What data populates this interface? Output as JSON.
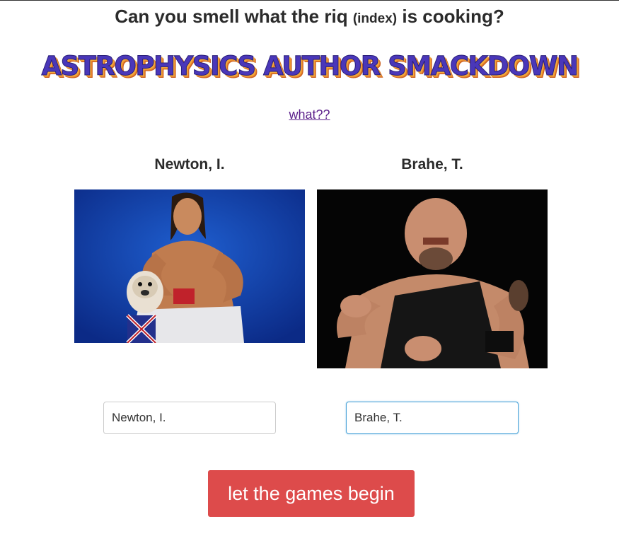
{
  "header": {
    "tagline_main": "Can you smell what the riq",
    "tagline_small": "(index)",
    "tagline_end": "is cooking?",
    "title": "ASTROPHYSICS AUTHOR SMACKDOWN",
    "what_link": "what??"
  },
  "contenders": [
    {
      "name": "Newton, I.",
      "photo_icon": "wrestler-with-bulldog-photo",
      "input_value": "Newton, I."
    },
    {
      "name": "Brahe, T.",
      "photo_icon": "wrestler-big-man-photo",
      "input_value": "Brahe, T."
    }
  ],
  "action": {
    "label": "let the games begin"
  },
  "colors": {
    "title": "#4a37b9",
    "title_shadow": "#f4a93b",
    "button": "#dd4b4b",
    "link": "#5a1e8a"
  }
}
